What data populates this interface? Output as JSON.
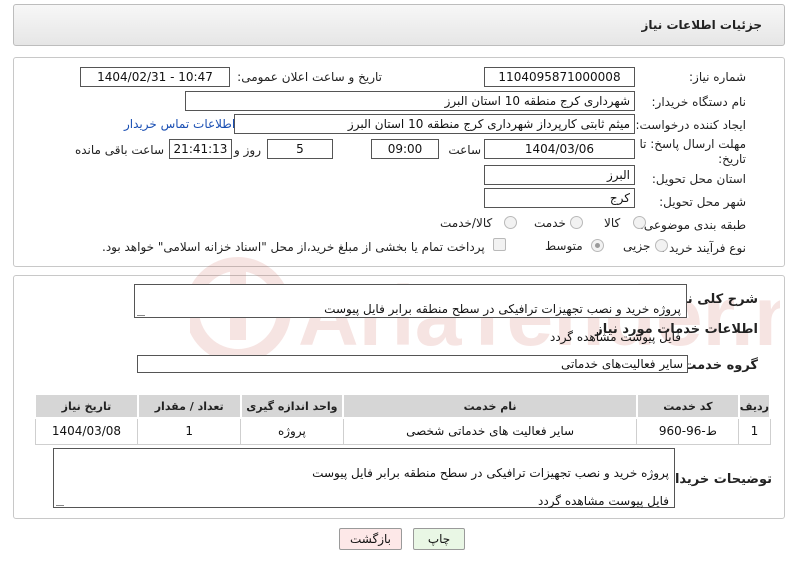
{
  "header": {
    "title": "جزئیات اطلاعات نیاز"
  },
  "form": {
    "need_number_label": "شماره نیاز:",
    "need_number_value": "1104095871000008",
    "announce_label": "تاریخ و ساعت اعلان عمومی:",
    "announce_value": "1404/02/31 - 10:47",
    "buyer_org_label": "نام دستگاه خریدار:",
    "buyer_org_value": "شهرداری کرج منطقه 10 استان البرز",
    "creator_label": "ایجاد کننده درخواست:",
    "creator_value": "میثم ثابتی کارپرداز شهرداری کرج منطقه 10 استان البرز",
    "contact_link": "اطلاعات تماس خریدار",
    "deadline_label_line1": "مهلت ارسال پاسخ: تا",
    "deadline_label_line2": "تاریخ:",
    "deadline_date": "1404/03/06",
    "time_label": "ساعت",
    "deadline_time": "09:00",
    "days_value": "5",
    "days_label": "روز و",
    "remaining_time": "21:41:13",
    "remaining_label": "ساعت باقی مانده",
    "province_label": "استان محل تحویل:",
    "province_value": "البرز",
    "city_label": "شهر محل تحویل:",
    "city_value": "کرج",
    "category_label": "طبقه بندی موضوعی:",
    "category_options": [
      "کالا",
      "خدمت",
      "کالا/خدمت"
    ],
    "category_selected": "خدمت",
    "process_label": "نوع فرآیند خرید :",
    "process_options": [
      "جزیی",
      "متوسط"
    ],
    "process_selected": "جزیی",
    "payment_note": "پرداخت تمام یا بخشی از مبلغ خرید،از محل \"اسناد خزانه اسلامی\" خواهد بود."
  },
  "need_summary": {
    "label": "شرح کلی نیاز:",
    "text_line1": "پروژه خرید و نصب تجهیزات ترافیکی در سطح منطقه برابر فایل پیوست",
    "text_line2": "فایل پیوست مشاهده گردد"
  },
  "services": {
    "section_title": "اطلاعات خدمات مورد نیاز",
    "group_label": "گروه خدمت:",
    "group_value": "سایر فعالیت‌های خدماتی",
    "columns": [
      "ردیف",
      "کد خدمت",
      "نام خدمت",
      "واحد اندازه گیری",
      "تعداد / مقدار",
      "تاریخ نیاز"
    ],
    "rows": [
      {
        "row": "1",
        "code": "ط-96-960",
        "name": "سایر فعالیت های خدماتی شخصی",
        "unit": "پروژه",
        "qty": "1",
        "date": "1404/03/08"
      }
    ]
  },
  "buyer_notes": {
    "label": "توضیحات خریدار:",
    "text_line1": "پروژه خرید و نصب تجهیزات ترافیکی در سطح منطقه برابر فایل پیوست",
    "text_line2": "فایل پیوست مشاهده گردد"
  },
  "buttons": {
    "print": "چاپ",
    "back": "بازگشت"
  },
  "watermark": {
    "text": "AriaTender.neT"
  },
  "colors": {
    "link": "#1a4fb3",
    "print_bg": "#e9f7e5",
    "back_bg": "#fde8e8",
    "watermark": "#c0392b"
  }
}
